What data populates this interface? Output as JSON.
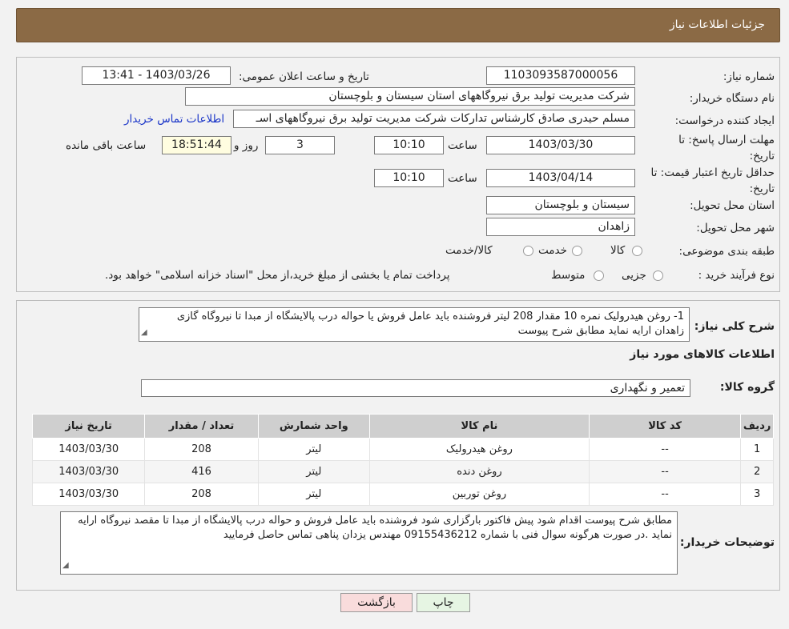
{
  "header": {
    "title": "جزئیات اطلاعات نیاز"
  },
  "form": {
    "need_number_label": "شماره نیاز:",
    "need_number": "1103093587000056",
    "announce_label": "تاریخ و ساعت اعلان عمومی:",
    "announce_value": "1403/03/26 - 13:41",
    "buyer_label": "نام دستگاه خریدار:",
    "buyer_value": "شرکت مدیریت تولید برق نیروگاههای استان سیستان و بلوچستان",
    "creator_label": "ایجاد کننده درخواست:",
    "creator_value": "مسلم حیدری صادق کارشناس تدارکات شرکت مدیریت تولید برق نیروگاههای اسـ",
    "contact_link": "اطلاعات تماس خریدار",
    "deadline_label": "مهلت ارسال پاسخ: تا تاریخ:",
    "deadline_date": "1403/03/30",
    "time_label": "ساعت",
    "deadline_time": "10:10",
    "days_value": "3",
    "days_label": "روز و",
    "remaining_time": "18:51:44",
    "remaining_label": "ساعت باقی مانده",
    "validity_label": "حداقل تاریخ اعتبار قیمت: تا تاریخ:",
    "validity_date": "1403/04/14",
    "validity_time": "10:10",
    "province_label": "استان محل تحویل:",
    "province_value": "سیستان و بلوچستان",
    "city_label": "شهر محل تحویل:",
    "city_value": "زاهدان",
    "category_label": "طبقه بندی موضوعی:",
    "category_options": [
      "کالا",
      "خدمت",
      "کالا/خدمت"
    ],
    "process_label": "نوع فرآیند خرید :",
    "process_options": [
      "جزیی",
      "متوسط"
    ],
    "process_note": "پرداخت تمام یا بخشی از مبلغ خرید،از محل \"اسناد خزانه اسلامی\" خواهد بود."
  },
  "description": {
    "label": "شرح کلی نیاز:",
    "text": "1-   روغن هیدرولیک نمره 10 مقدار 208 لیتر فروشنده باید عامل فروش یا حواله درب پالایشگاه از مبدا تا نیروگاه گازی زاهدان ارایه نماید مطابق شرح پیوست"
  },
  "goods": {
    "section_title": "اطلاعات کالاهای مورد نیاز",
    "group_label": "گروه کالا:",
    "group_value": "تعمیر و نگهداری",
    "columns": [
      "ردیف",
      "کد کالا",
      "نام کالا",
      "واحد شمارش",
      "تعداد / مقدار",
      "تاریخ نیاز"
    ],
    "rows": [
      {
        "idx": "1",
        "code": "--",
        "name": "روغن هیدرولیک",
        "unit": "لیتر",
        "qty": "208",
        "date": "1403/03/30"
      },
      {
        "idx": "2",
        "code": "--",
        "name": "روغن دنده",
        "unit": "لیتر",
        "qty": "416",
        "date": "1403/03/30"
      },
      {
        "idx": "3",
        "code": "--",
        "name": "روغن توربین",
        "unit": "لیتر",
        "qty": "208",
        "date": "1403/03/30"
      }
    ]
  },
  "buyer_notes": {
    "label": "توضیحات خریدار:",
    "text": "مطابق شرح پیوست اقدام شود پیش فاکتور بارگزاری شود  فروشنده باید عامل فروش و حواله درب پالایشگاه از مبدا تا مقصد نیروگاه ارایه نماید .در صورت هرگونه سوال فنی با شماره 09155436212 مهندس یزدان  پناهی تماس حاصل فرمایید"
  },
  "buttons": {
    "print": "چاپ",
    "back": "بازگشت"
  },
  "colors": {
    "header_bg": "#8b6a45",
    "link": "#1a35c8",
    "time_bg": "#fffde0",
    "back_bg": "#f9dcdc",
    "print_bg": "#e6f5e3"
  }
}
